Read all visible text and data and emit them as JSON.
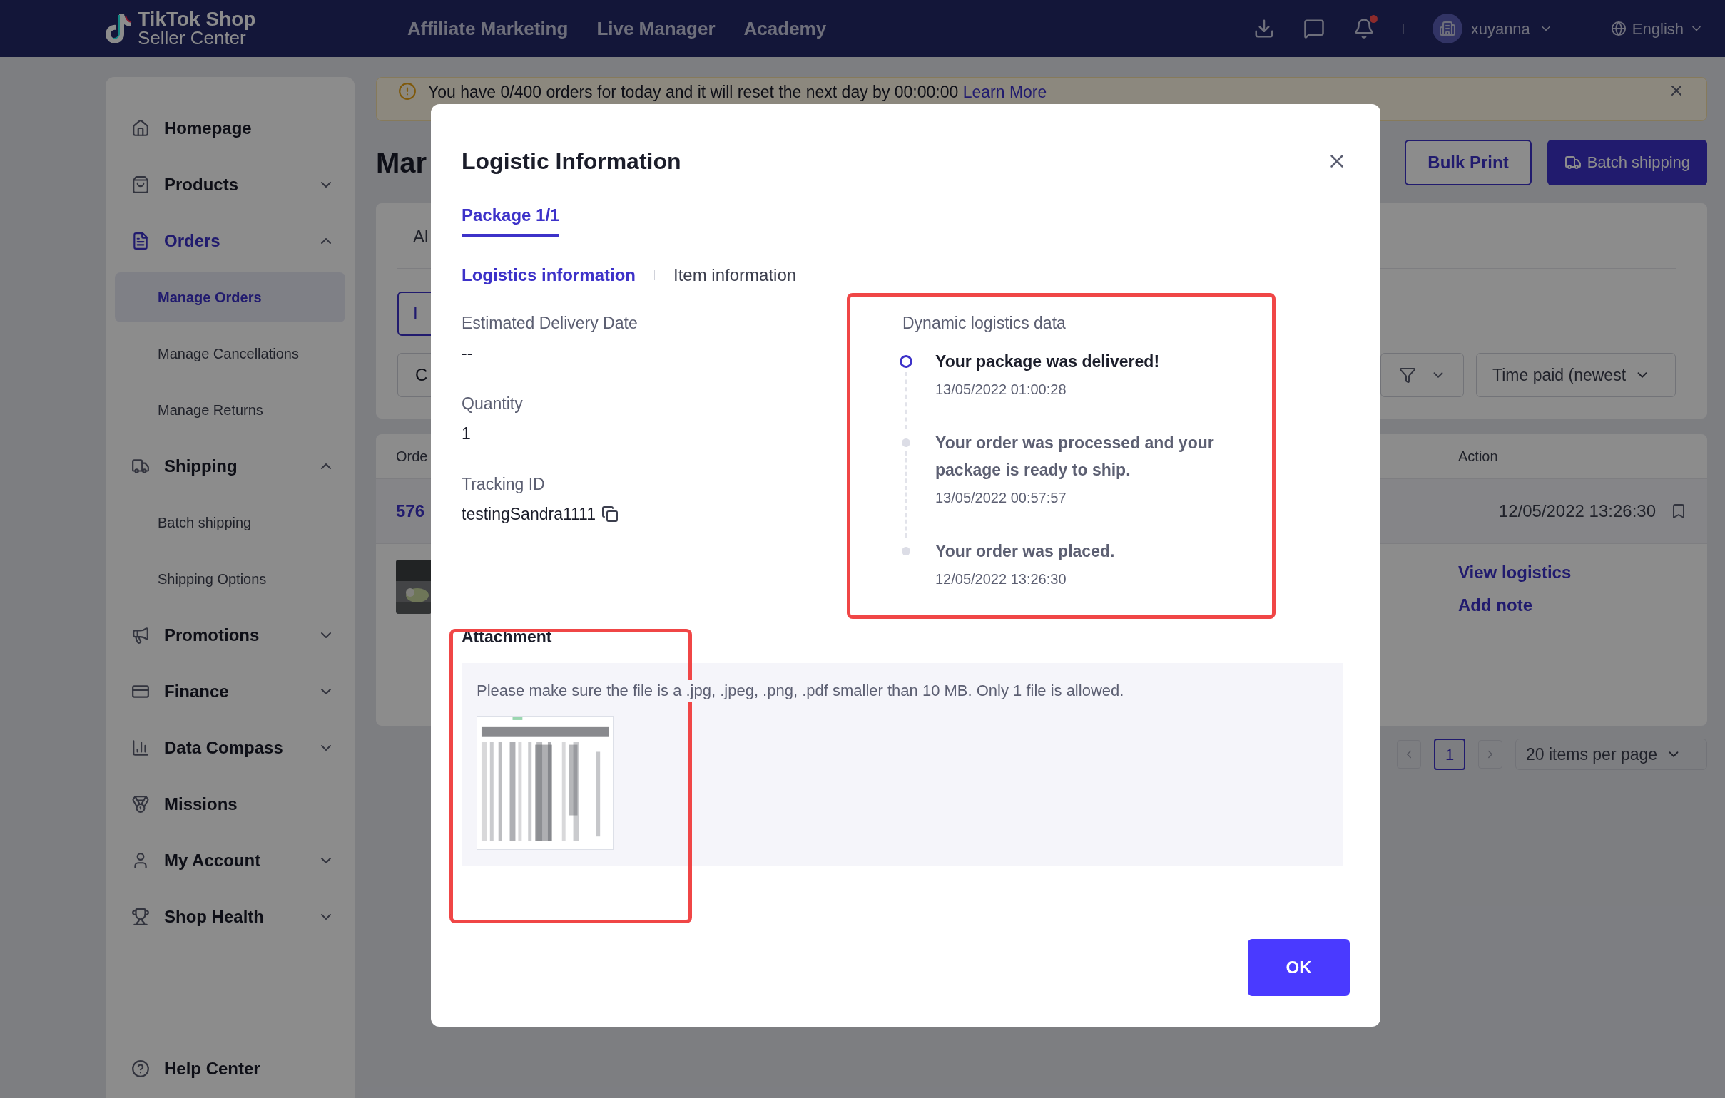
{
  "top_bar": {
    "logo_title": "TikTok Shop",
    "logo_subtitle": "Seller Center",
    "nav": [
      {
        "label": "Affiliate Marketing"
      },
      {
        "label": "Live Manager"
      },
      {
        "label": "Academy"
      }
    ],
    "notification_dot": true,
    "user": "xuyanna",
    "language": "English"
  },
  "sidebar": {
    "items": [
      {
        "label": "Homepage",
        "kind": "link",
        "selected": false
      },
      {
        "label": "Products",
        "kind": "group",
        "expanded": false,
        "selected": false
      },
      {
        "label": "Orders",
        "kind": "group",
        "expanded": true,
        "selected": true,
        "children": [
          {
            "label": "Manage Orders",
            "selected": true
          },
          {
            "label": "Manage Cancellations",
            "selected": false
          },
          {
            "label": "Manage Returns",
            "selected": false
          }
        ]
      },
      {
        "label": "Shipping",
        "kind": "group",
        "expanded": true,
        "selected": false,
        "children": [
          {
            "label": "Batch shipping",
            "selected": false
          },
          {
            "label": "Shipping Options",
            "selected": false
          }
        ]
      },
      {
        "label": "Promotions",
        "kind": "group",
        "expanded": false,
        "selected": false
      },
      {
        "label": "Finance",
        "kind": "group",
        "expanded": false,
        "selected": false
      },
      {
        "label": "Data Compass",
        "kind": "group",
        "expanded": false,
        "selected": false
      },
      {
        "label": "Missions",
        "kind": "link",
        "selected": false
      },
      {
        "label": "My Account",
        "kind": "group",
        "expanded": false,
        "selected": false
      },
      {
        "label": "Shop Health",
        "kind": "group",
        "expanded": false,
        "selected": false
      }
    ],
    "footer_item": {
      "label": "Help Center"
    }
  },
  "notice": {
    "message": "You have 0/400 orders for today and it will reset the next day by 00:00:00",
    "link": "Learn More"
  },
  "page": {
    "title": "Mar",
    "buttons": [
      {
        "label": "Bulk Print",
        "kind": "outline"
      },
      {
        "label": "Batch shipping",
        "kind": "primary"
      }
    ]
  },
  "filters": {
    "tab": "Al",
    "button": "I",
    "field": "C",
    "sort": "Time paid (newest"
  },
  "table": {
    "columns": [
      {
        "label": "Orde"
      },
      {
        "label": "Action"
      }
    ],
    "row": {
      "order_id": "576",
      "time": "12/05/2022 13:26:30",
      "actions": [
        "View logistics",
        "Add note"
      ]
    }
  },
  "pagination": {
    "pages": [
      {
        "label": "1",
        "selected": true
      }
    ],
    "page_size": "20 items per page"
  },
  "modal": {
    "title": "Logistic Information",
    "package_tabs": [
      {
        "label": "Package 1/1",
        "selected": true
      }
    ],
    "section_tabs": [
      {
        "label": "Logistics information",
        "selected": true
      },
      {
        "label": "Item information",
        "selected": false
      }
    ],
    "fields": [
      {
        "label": "Estimated Delivery Date",
        "value": "--"
      },
      {
        "label": "Quantity",
        "value": "1"
      },
      {
        "label": "Tracking ID",
        "value": "testingSandra1111",
        "copyable": true
      }
    ],
    "tracking": {
      "title": "Dynamic logistics data",
      "events": [
        {
          "text": "Your package was delivered!",
          "time": "13/05/2022 01:00:28",
          "current": true
        },
        {
          "text": "Your order was processed and your package is ready to ship.",
          "time": "13/05/2022 00:57:57",
          "current": false
        },
        {
          "text": "Your order was placed.",
          "time": "12/05/2022 13:26:30",
          "current": false
        }
      ]
    },
    "attachment": {
      "title": "Attachment",
      "hint": "Please make sure the file is a .jpg, .jpeg, .png, .pdf smaller than 10 MB. Only 1 file is allowed."
    },
    "ok": "OK"
  }
}
